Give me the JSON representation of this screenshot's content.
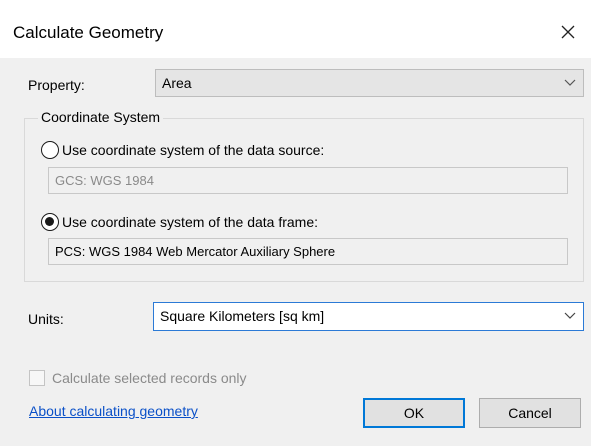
{
  "window": {
    "title": "Calculate Geometry",
    "close_icon": "close-icon"
  },
  "property": {
    "label": "Property:",
    "value": "Area"
  },
  "coordinate_system": {
    "legend": "Coordinate System",
    "option_source": {
      "label": "Use coordinate system of the data source:",
      "value": "GCS: WGS 1984",
      "checked": false
    },
    "option_frame": {
      "label": "Use coordinate system of the data frame:",
      "value": "PCS: WGS 1984 Web Mercator Auxiliary Sphere",
      "checked": true
    }
  },
  "units": {
    "label": "Units:",
    "value": "Square Kilometers [sq km]"
  },
  "selected_only": {
    "label": "Calculate selected records only",
    "checked": false
  },
  "help_link": "About calculating geometry",
  "buttons": {
    "ok": "OK",
    "cancel": "Cancel"
  },
  "colors": {
    "accent": "#0078d7",
    "link": "#0a50c8"
  }
}
